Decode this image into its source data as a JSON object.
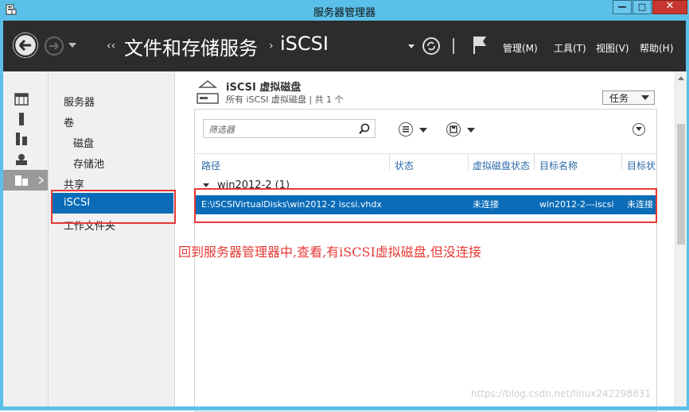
{
  "window": {
    "title": "服务器管理器",
    "min_glyph": "—",
    "max_glyph": "□",
    "close_glyph": "✕"
  },
  "header": {
    "breadcrumb": [
      "文件和存储服务",
      "iSCSI"
    ],
    "menus": [
      "管理(M)",
      "工具(T)",
      "视图(V)",
      "帮助(H)"
    ]
  },
  "left_icons": [
    "dashboard-icon",
    "local-server-icon",
    "all-servers-icon",
    "file-storage-role-icon",
    "file-storage-services-icon"
  ],
  "subnav": {
    "items": [
      {
        "label": "服务器",
        "indent": false,
        "selected": false
      },
      {
        "label": "卷",
        "indent": false,
        "selected": false
      },
      {
        "label": "磁盘",
        "indent": true,
        "selected": false
      },
      {
        "label": "存储池",
        "indent": true,
        "selected": false
      },
      {
        "label": "共享",
        "indent": false,
        "selected": false
      },
      {
        "label": "iSCSI",
        "indent": false,
        "selected": true
      },
      {
        "label": "工作文件夹",
        "indent": false,
        "selected": false
      }
    ]
  },
  "section": {
    "title": "iSCSI 虚拟磁盘",
    "subtitle": "所有 iSCSI 虚拟磁盘 | 共 1 个",
    "tasks_label": "任务"
  },
  "filter": {
    "placeholder": "筛选器"
  },
  "table": {
    "columns": [
      "路径",
      "状态",
      "虚拟磁盘状态",
      "目标名称",
      "目标状"
    ],
    "group": "win2012-2 (1)",
    "rows": [
      {
        "path": "E:\\iSCSIVirtualDisks\\win2012-2 iscsi.vhdx",
        "status": "",
        "disk_status": "未连接",
        "target_name": "win2012-2---iscsi",
        "target_status": "未连接"
      }
    ]
  },
  "annotation": {
    "text": "回到服务器管理器中,查看,有iSCSI虚拟磁盘,但没连接"
  },
  "watermark": "https://blog.csdn.net/linux242298831",
  "colors": {
    "titlebar": "#5bc0e8",
    "header": "#2c2c2c",
    "selection": "#0a6cb8",
    "annotation": "#e53935"
  }
}
